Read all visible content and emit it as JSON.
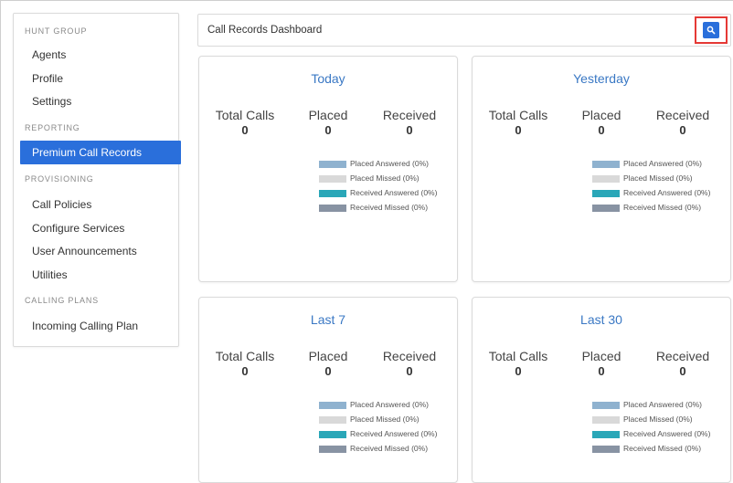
{
  "sidebar": {
    "sections": [
      {
        "label": "HUNT GROUP"
      },
      {
        "label": "REPORTING"
      },
      {
        "label": "PROVISIONING"
      },
      {
        "label": "CALLING PLANS"
      }
    ],
    "items": [
      {
        "label": "Agents"
      },
      {
        "label": "Profile"
      },
      {
        "label": "Settings"
      },
      {
        "label": "Premium Call Records"
      },
      {
        "label": "Call Policies"
      },
      {
        "label": "Configure Services"
      },
      {
        "label": "User Announcements"
      },
      {
        "label": "Utilities"
      },
      {
        "label": "Incoming Calling Plan"
      }
    ],
    "active_color": "#2a6fdb"
  },
  "header": {
    "title": "Call Records Dashboard",
    "search_icon": "search-icon"
  },
  "stat_labels": {
    "total": "Total Calls",
    "placed": "Placed",
    "received": "Received"
  },
  "legend": [
    {
      "label": "Placed Answered (0%)",
      "color": "#8fb2cf"
    },
    {
      "label": "Placed Missed (0%)",
      "color": "#d9d9d9"
    },
    {
      "label": "Received Answered (0%)",
      "color": "#2aa7b8"
    },
    {
      "label": "Received Missed (0%)",
      "color": "#8893a3"
    }
  ],
  "cards": [
    {
      "title": "Today",
      "total": "0",
      "placed": "0",
      "received": "0"
    },
    {
      "title": "Yesterday",
      "total": "0",
      "placed": "0",
      "received": "0"
    },
    {
      "title": "Last 7",
      "total": "0",
      "placed": "0",
      "received": "0"
    },
    {
      "title": "Last 30",
      "total": "0",
      "placed": "0",
      "received": "0"
    }
  ]
}
